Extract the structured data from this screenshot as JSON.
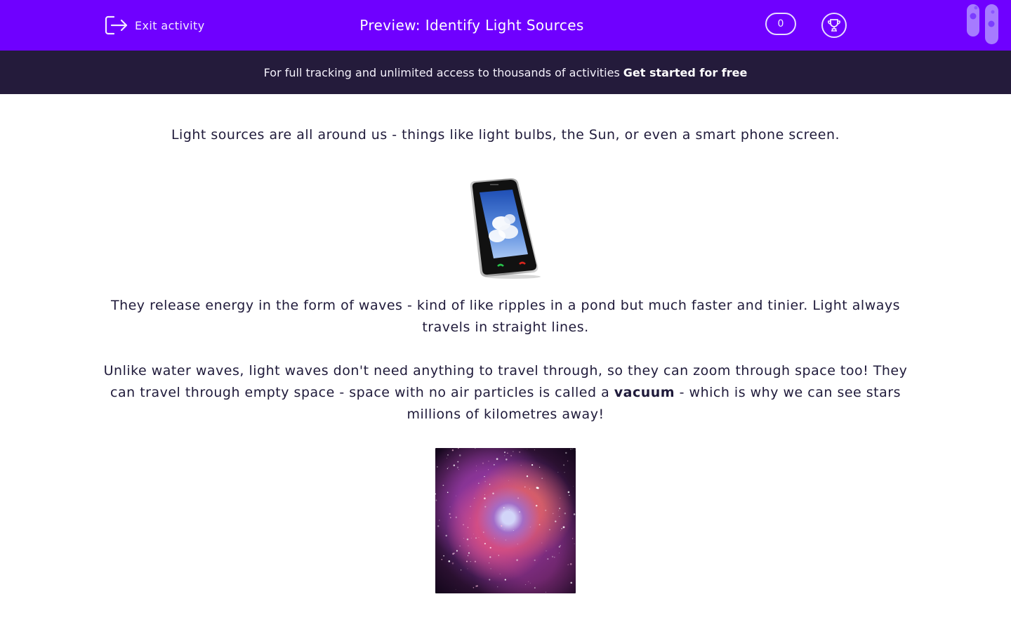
{
  "header": {
    "exit_label": "Exit activity",
    "title": "Preview: Identify Light Sources",
    "score": "0",
    "brand_color": "#6f00ff"
  },
  "banner": {
    "text": "For full tracking and unlimited access to thousands of activities",
    "cta": "Get started for free",
    "background": "#241b3b"
  },
  "content": {
    "p1": "Light sources are all around us - things like light bulbs, the Sun, or even a smart phone screen.",
    "p2": "They release energy in the form of waves - kind of like ripples in a pond but much faster and tinier. Light always travels in straight lines.",
    "p3_before": "Unlike water waves, light waves don't need anything to travel through, so they can zoom through space too! They can travel through empty space - space with no air particles is called a",
    "p3_bold": "vacuum",
    "p3_after": "-  which is why we can see stars millions of kilometres away!",
    "image1": "smartphone-with-cloud-sky-screen",
    "image2": "nebula-star-field"
  }
}
